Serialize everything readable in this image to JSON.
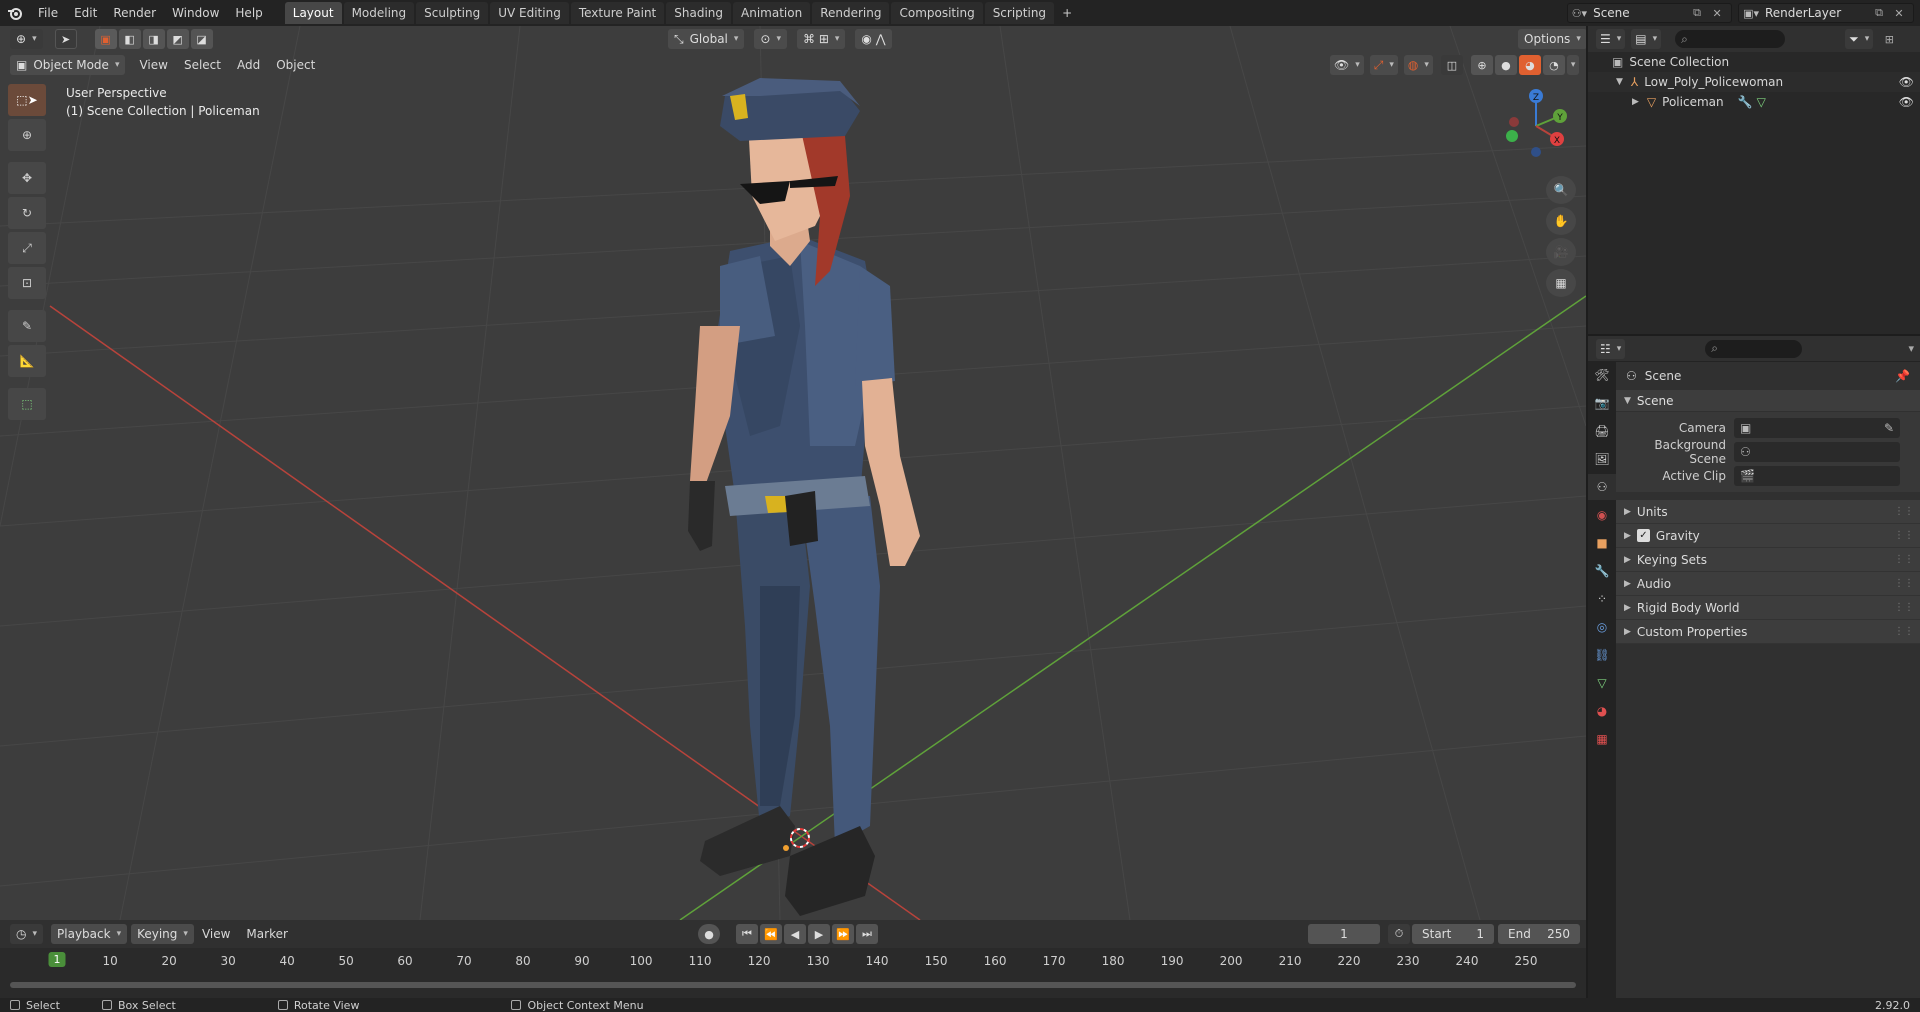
{
  "menubar": {
    "items": [
      "File",
      "Edit",
      "Render",
      "Window",
      "Help"
    ],
    "workspaces": [
      "Layout",
      "Modeling",
      "Sculpting",
      "UV Editing",
      "Texture Paint",
      "Shading",
      "Animation",
      "Rendering",
      "Compositing",
      "Scripting"
    ],
    "active_workspace": "Layout",
    "add_tab": "+",
    "scene_name": "Scene",
    "view_layer": "RenderLayer"
  },
  "viewport": {
    "mode": "Object Mode",
    "menus": [
      "View",
      "Select",
      "Add",
      "Object"
    ],
    "transform_orientation": "Global",
    "options_label": "Options",
    "overlay_line1": "User Perspective",
    "overlay_line2": "(1) Scene Collection | Policeman",
    "gizmo": {
      "x": "X",
      "y": "Y",
      "z": "Z"
    }
  },
  "timeline": {
    "menus": [
      "Playback",
      "Keying",
      "View",
      "Marker"
    ],
    "current_frame": "1",
    "start_label": "Start",
    "start_value": "1",
    "end_label": "End",
    "end_value": "250",
    "ruler_labels": [
      "10",
      "20",
      "30",
      "40",
      "50",
      "60",
      "70",
      "80",
      "90",
      "100",
      "110",
      "120",
      "130",
      "140",
      "150",
      "160",
      "170",
      "180",
      "190",
      "200",
      "210",
      "220",
      "230",
      "240",
      "250"
    ],
    "current_marker": "1"
  },
  "statusbar": {
    "select": "Select",
    "box_select": "Box Select",
    "rotate_view": "Rotate View",
    "context_menu": "Object Context Menu",
    "version": "2.92.0"
  },
  "outliner": {
    "root": "Scene Collection",
    "collection": "Low_Poly_Policewoman",
    "object": "Policeman"
  },
  "properties": {
    "context_title": "Scene",
    "panel_title": "Scene",
    "camera_label": "Camera",
    "background_scene_label": "Background Scene",
    "active_clip_label": "Active Clip",
    "subpanels": [
      "Units",
      "Gravity",
      "Keying Sets",
      "Audio",
      "Rigid Body World",
      "Custom Properties"
    ],
    "gravity_checked": true
  },
  "colors": {
    "accent": "#4772b3",
    "active_tool": "#e06030",
    "x_axis": "#b8433b",
    "y_axis": "#5fa23a",
    "z_axis": "#3a7bd5"
  }
}
